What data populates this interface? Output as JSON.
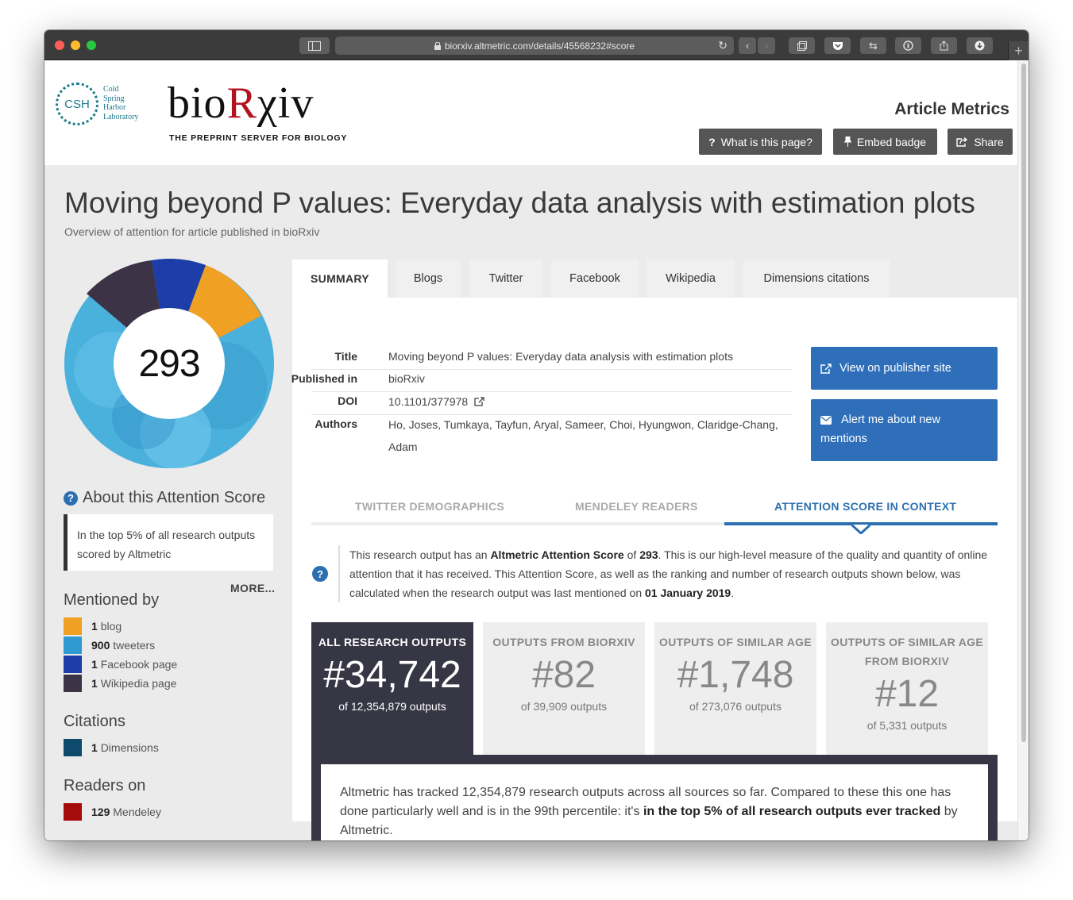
{
  "browser": {
    "url": "biorxiv.altmetric.com/details/45568232#score"
  },
  "header": {
    "csh_mark": "CSH",
    "csh_lines": [
      "Cold",
      "Spring",
      "Harbor",
      "Laboratory"
    ],
    "wordmark_a": "bio",
    "wordmark_r": "R",
    "wordmark_b": "χiv",
    "tagline": "THE PREPRINT SERVER FOR BIOLOGY",
    "section_title": "Article Metrics",
    "buttons": {
      "what": "What is this page?",
      "embed": "Embed badge",
      "share": "Share"
    }
  },
  "article": {
    "title": "Moving beyond P values: Everyday data analysis with estimation plots",
    "subtitle": "Overview of attention for article published in bioRxiv"
  },
  "score": {
    "value": "293",
    "donut_segments": [
      {
        "source": "blog",
        "color": "#f0a022"
      },
      {
        "source": "twitter",
        "color": "#5ab4e0"
      },
      {
        "source": "facebook",
        "color": "#1d3ea8"
      },
      {
        "source": "wikipedia",
        "color": "#3d3346"
      }
    ]
  },
  "about": {
    "heading": "About this Attention Score",
    "text": "In the top 5% of all research outputs scored by Altmetric",
    "more": "MORE..."
  },
  "mentioned_by": {
    "heading": "Mentioned by",
    "items": [
      {
        "count": "1",
        "label": "blog",
        "color": "#f0a022"
      },
      {
        "count": "900",
        "label": "tweeters",
        "color": "#2e9ad0"
      },
      {
        "count": "1",
        "label": "Facebook page",
        "color": "#1d3ea8"
      },
      {
        "count": "1",
        "label": "Wikipedia page",
        "color": "#3d3346"
      }
    ]
  },
  "citations": {
    "heading": "Citations",
    "items": [
      {
        "count": "1",
        "label": "Dimensions",
        "color": "#0e4a6b"
      }
    ]
  },
  "readers": {
    "heading": "Readers on",
    "items": [
      {
        "count": "129",
        "label": "Mendeley",
        "color": "#a50b0b"
      }
    ]
  },
  "tabs": [
    "SUMMARY",
    "Blogs",
    "Twitter",
    "Facebook",
    "Wikipedia",
    "Dimensions citations"
  ],
  "meta": {
    "title_label": "Title",
    "title_value": "Moving beyond P values: Everyday data analysis with estimation plots",
    "published_label": "Published in",
    "published_value": "bioRxiv",
    "doi_label": "DOI",
    "doi_value": "10.1101/377978",
    "authors_label": "Authors",
    "authors_value_1": "Ho, Joses, Tumkaya, Tayfun, Aryal, Sameer, Choi, Hyungwon, Claridge-Chang,",
    "authors_value_2": "Adam"
  },
  "actions": {
    "view": "View on publisher site",
    "alert_1": "Alert me about new",
    "alert_2": "mentions"
  },
  "subtabs": [
    "TWITTER DEMOGRAPHICS",
    "MENDELEY READERS",
    "ATTENTION SCORE IN CONTEXT"
  ],
  "info": {
    "t1": "This research output has an ",
    "b1": "Altmetric Attention Score",
    "t2": " of ",
    "b2": "293",
    "t3": ". This is our high-level measure of the quality and quantity of online attention that it has received. This Attention Score, as well as the ranking and number of research outputs shown below, was calculated when the research output was last mentioned on ",
    "b3": "01 January 2019",
    "t4": "."
  },
  "stats": [
    {
      "label_1": "ALL RESEARCH OUTPUTS",
      "label_2": "",
      "rank": "#34,742",
      "of": "of 12,354,879 outputs"
    },
    {
      "label_1": "OUTPUTS FROM BIORXIV",
      "label_2": "",
      "rank": "#82",
      "of": "of 39,909 outputs"
    },
    {
      "label_1": "OUTPUTS OF SIMILAR AGE",
      "label_2": "",
      "rank": "#1,748",
      "of": "of 273,076 outputs"
    },
    {
      "label_1": "OUTPUTS OF SIMILAR AGE",
      "label_2": "FROM BIORXIV",
      "rank": "#12",
      "of": "of 5,331 outputs"
    }
  ],
  "summary": {
    "t1": "Altmetric has tracked 12,354,879 research outputs across all sources so far. Compared to these this one has done particularly well and is in the 99th percentile: it's ",
    "b1": "in the top 5% of all research outputs ever tracked",
    "t2": " by Altmetric."
  }
}
